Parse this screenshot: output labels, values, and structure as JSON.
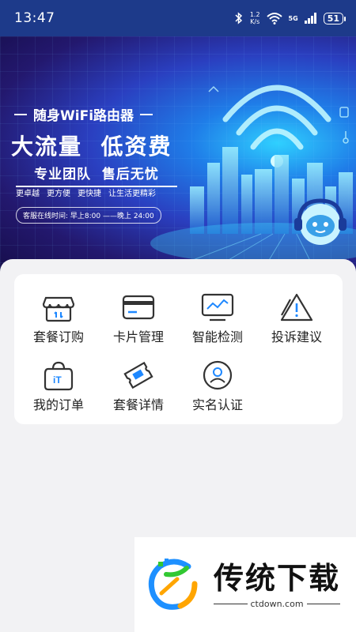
{
  "status_bar": {
    "time": "13:47",
    "speed_value": "1.2",
    "speed_unit": "K/s",
    "network": "5G",
    "battery": "51"
  },
  "banner": {
    "subtitle": "随身WiFi路由器",
    "title": "大流量  低资费",
    "tagline": "专业团队  售后无忧",
    "features": [
      "更卓越",
      "更方便",
      "更快捷",
      "让生活更精彩"
    ],
    "service_hours": "客服在线时间: 早上8:00 ——晚上 24:00"
  },
  "menu": {
    "items": [
      {
        "label": "套餐订购",
        "icon": "shop-icon"
      },
      {
        "label": "卡片管理",
        "icon": "card-icon"
      },
      {
        "label": "智能检测",
        "icon": "monitor-icon"
      },
      {
        "label": "投诉建议",
        "icon": "warning-icon"
      },
      {
        "label": "我的订单",
        "icon": "order-bag-icon"
      },
      {
        "label": "套餐详情",
        "icon": "ticket-icon"
      },
      {
        "label": "实名认证",
        "icon": "user-verify-icon"
      }
    ]
  },
  "watermark": {
    "title": "传统下载",
    "url": "ctdown.com"
  },
  "colors": {
    "status_bar": "#1d3a8a",
    "banner_dark": "#160d4a",
    "banner_light": "#2fd0ff",
    "card_bg": "#ffffff",
    "page_bg": "#f2f2f4"
  }
}
